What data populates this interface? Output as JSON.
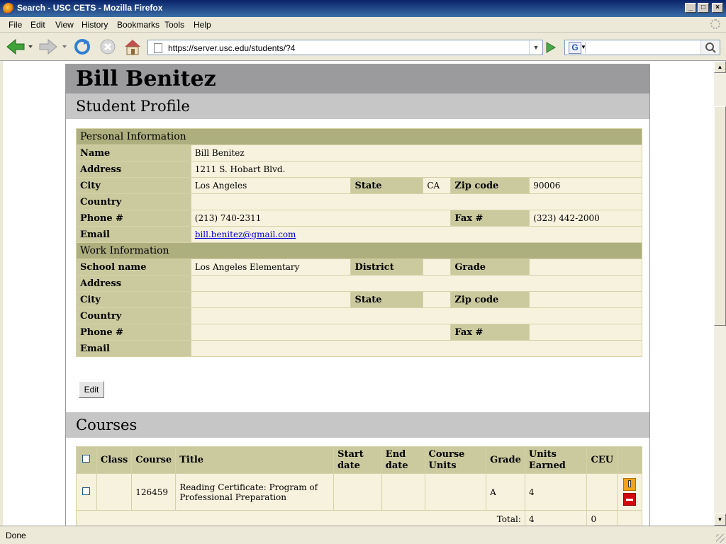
{
  "window": {
    "title": "Search - USC CETS - Mozilla Firefox"
  },
  "menu": [
    "File",
    "Edit",
    "View",
    "History",
    "Bookmarks",
    "Tools",
    "Help"
  ],
  "address": {
    "url": "https://server.usc.edu/students/?4"
  },
  "search": {
    "value": ""
  },
  "status": {
    "text": "Done"
  },
  "student": {
    "name": "Bill Benitez",
    "profile_heading": "Student Profile",
    "personal": {
      "heading": "Personal Information",
      "labels": {
        "name": "Name",
        "address": "Address",
        "city": "City",
        "state": "State",
        "zip": "Zip code",
        "country": "Country",
        "phone": "Phone #",
        "fax": "Fax #",
        "email": "Email"
      },
      "name": "Bill Benitez",
      "address": "1211 S. Hobart Blvd.",
      "city": "Los Angeles",
      "state": "CA",
      "zip": "90006",
      "country": "",
      "phone": "(213) 740-2311",
      "fax": "(323) 442-2000",
      "email": "bill.benitez@gmail.com"
    },
    "work": {
      "heading": "Work Information",
      "labels": {
        "school": "School name",
        "district": "District",
        "grade": "Grade",
        "address": "Address",
        "city": "City",
        "state": "State",
        "zip": "Zip code",
        "country": "Country",
        "phone": "Phone #",
        "fax": "Fax #",
        "email": "Email"
      },
      "school": "Los Angeles Elementary",
      "district": "",
      "grade": "",
      "address": "",
      "city": "",
      "state": "",
      "zip": "",
      "country": "",
      "phone": "",
      "fax": "",
      "email": ""
    },
    "edit_label": "Edit"
  },
  "courses": {
    "heading": "Courses",
    "columns": {
      "class": "Class",
      "course": "Course",
      "title": "Title",
      "start": "Start date",
      "end": "End date",
      "units": "Course Units",
      "grade": "Grade",
      "earned": "Units Earned",
      "ceu": "CEU"
    },
    "rows": [
      {
        "class": "",
        "course": "126459",
        "title": "Reading Certificate: Program of Professional Preparation",
        "start": "",
        "end": "",
        "units": "",
        "grade": "A",
        "earned": "4",
        "ceu": ""
      }
    ],
    "total_label": "Total:",
    "total_earned": "4",
    "total_ceu": "0"
  }
}
